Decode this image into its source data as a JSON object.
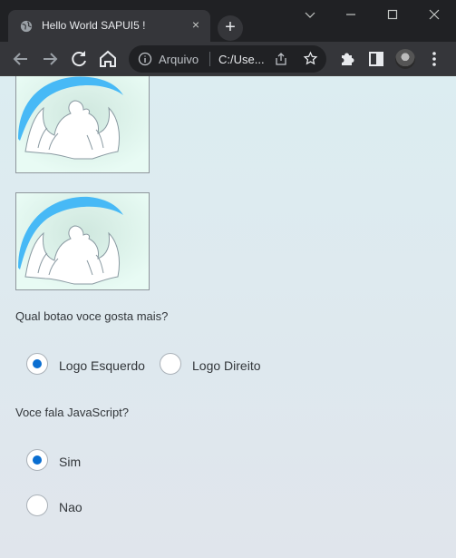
{
  "browser": {
    "tab_title": "Hello World SAPUI5 !",
    "tab_close": "×",
    "new_tab": "+",
    "address_scheme_label": "Arquivo",
    "address_url": "C:/Use...",
    "icons": {
      "back": "arrow-left-icon",
      "forward": "arrow-right-icon",
      "reload": "reload-icon",
      "home": "home-icon",
      "info": "info-icon",
      "share": "share-icon",
      "bookmark": "star-icon",
      "extensions": "puzzle-icon",
      "side_panel": "side-panel-icon",
      "menu": "kebab-menu-icon"
    },
    "window_controls": [
      "chevron-down-icon",
      "minimize-icon",
      "maximize-icon",
      "close-icon"
    ]
  },
  "content": {
    "question_1": "Qual botao voce gosta mais?",
    "group_1": [
      {
        "label": "Logo Esquerdo",
        "selected": true
      },
      {
        "label": "Logo Direito",
        "selected": false
      }
    ],
    "question_2": "Voce fala JavaScript?",
    "group_2": [
      {
        "label": "Sim",
        "selected": true
      },
      {
        "label": "Nao",
        "selected": false
      }
    ]
  },
  "colors": {
    "accent": "#0a6ed1",
    "logo_arc": "#47b9f6",
    "chrome_dark": "#202124",
    "chrome_toolbar": "#35363a"
  }
}
